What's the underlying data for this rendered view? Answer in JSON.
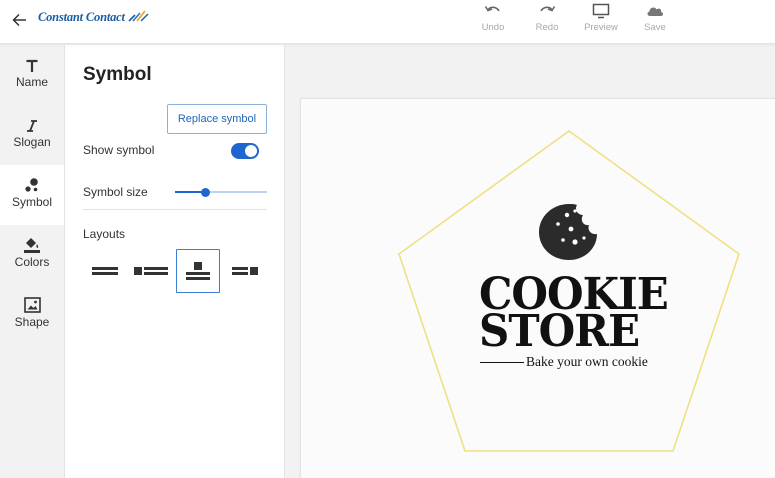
{
  "app": {
    "brand": "Constant Contact",
    "colors": {
      "accent": "#1f66d0",
      "brand_blue": "#1a5ea8",
      "pentagon_stroke": "#efe085"
    }
  },
  "toolbar": {
    "back_icon": "arrow-left-icon",
    "undo": {
      "label": "Undo",
      "icon": "undo-icon"
    },
    "redo": {
      "label": "Redo",
      "icon": "redo-icon"
    },
    "preview": {
      "label": "Preview",
      "icon": "monitor-icon"
    },
    "save": {
      "label": "Save",
      "icon": "cloud-icon"
    }
  },
  "sidebar": {
    "items": [
      {
        "label": "Name",
        "icon": "text-t-icon",
        "active": false
      },
      {
        "label": "Slogan",
        "icon": "italic-i-icon",
        "active": false
      },
      {
        "label": "Symbol",
        "icon": "symbol-dots-icon",
        "active": true
      },
      {
        "label": "Colors",
        "icon": "paint-bucket-icon",
        "active": false
      },
      {
        "label": "Shape",
        "icon": "image-frame-icon",
        "active": false
      }
    ]
  },
  "panel": {
    "title": "Symbol",
    "replace_label": "Replace symbol",
    "show_symbol_label": "Show symbol",
    "show_symbol_on": true,
    "symbol_size_label": "Symbol size",
    "symbol_size_value": 0.33,
    "layouts_label": "Layouts",
    "layouts": [
      "layout-lines-icon",
      "layout-left-icon",
      "layout-top-icon",
      "layout-right-icon"
    ],
    "selected_layout_index": 2
  },
  "canvas": {
    "title_line1": "COOKIE",
    "title_line2": "STORE",
    "tagline": "Bake your own cookie",
    "symbol_icon": "cookie-icon",
    "frame_shape": "pentagon"
  }
}
